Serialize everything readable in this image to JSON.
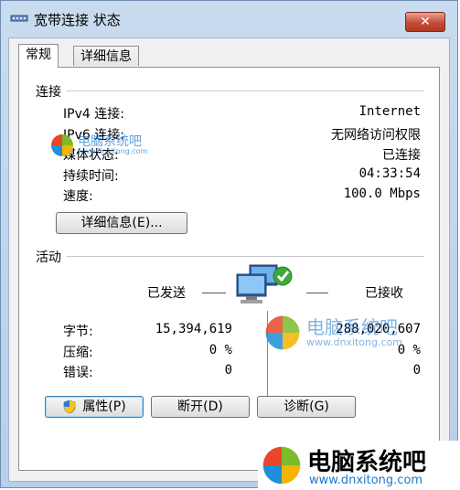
{
  "window": {
    "title": "宽带连接 状态",
    "close_label": "✕"
  },
  "tabs": [
    {
      "label": "常规"
    },
    {
      "label": "详细信息"
    }
  ],
  "connection": {
    "section_label": "连接",
    "rows": [
      {
        "label": "IPv4 连接:",
        "value": "Internet"
      },
      {
        "label": "IPv6 连接:",
        "value": "无网络访问权限"
      },
      {
        "label": "媒体状态:",
        "value": "已连接"
      },
      {
        "label": "持续时间:",
        "value": "04:33:54"
      },
      {
        "label": "速度:",
        "value": "100.0 Mbps"
      }
    ],
    "details_button": "详细信息(E)..."
  },
  "activity": {
    "section_label": "活动",
    "sent_label": "已发送",
    "received_label": "已接收",
    "rows": [
      {
        "label": "字节:",
        "sent": "15,394,619",
        "received": "288,020,607"
      },
      {
        "label": "压缩:",
        "sent": "0 %",
        "received": "0 %"
      },
      {
        "label": "错误:",
        "sent": "0",
        "received": "0"
      }
    ]
  },
  "buttons": {
    "properties": "属性(P)",
    "disconnect": "断开(D)",
    "diagnose": "诊断(G)"
  },
  "watermark": {
    "brand": "电脑系统吧",
    "url": "www.dnxitong.com"
  },
  "colors": {
    "title_bar": "#c9dcef",
    "close_button": "#c44c36",
    "focus_border": "#3c7fb1",
    "watermark_blue": "#1a7ad0"
  }
}
